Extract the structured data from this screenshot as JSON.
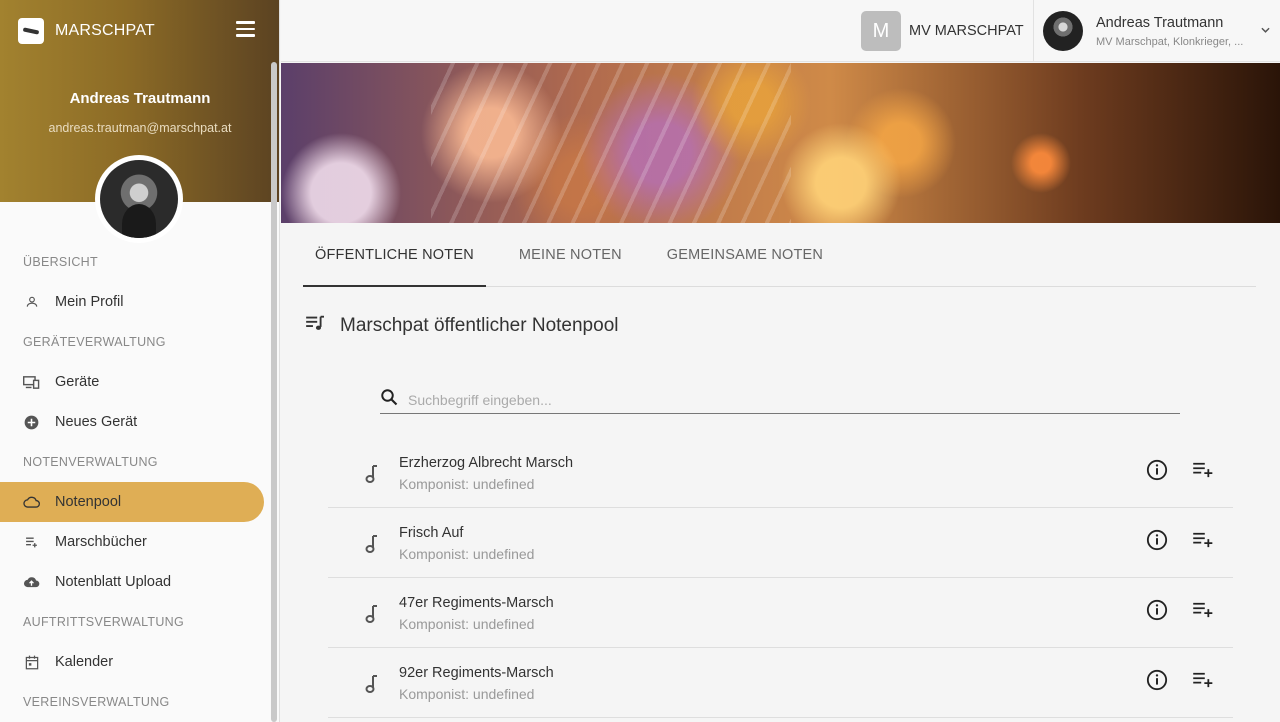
{
  "brand": {
    "name": "MARSCHPAT"
  },
  "profile": {
    "name": "Andreas Trautmann",
    "email": "andreas.trautman@marschpat.at"
  },
  "nav": {
    "sections": [
      {
        "label": "ÜBERSICHT",
        "items": [
          {
            "label": "Mein Profil",
            "icon": "person-icon"
          }
        ]
      },
      {
        "label": "GERÄTEVERWALTUNG",
        "items": [
          {
            "label": "Geräte",
            "icon": "devices-icon"
          },
          {
            "label": "Neues Gerät",
            "icon": "add-circle-icon"
          }
        ]
      },
      {
        "label": "NOTENVERWALTUNG",
        "items": [
          {
            "label": "Notenpool",
            "icon": "cloud-icon",
            "active": true
          },
          {
            "label": "Marschbücher",
            "icon": "playlist-icon"
          },
          {
            "label": "Notenblatt Upload",
            "icon": "cloud-upload-icon"
          }
        ]
      },
      {
        "label": "AUFTRITTSVERWALTUNG",
        "items": [
          {
            "label": "Kalender",
            "icon": "calendar-icon"
          }
        ]
      },
      {
        "label": "VEREINSVERWALTUNG",
        "items": []
      }
    ]
  },
  "topbar": {
    "org_initial": "M",
    "org_name": "MV MARSCHPAT",
    "user_name": "Andreas Trautmann",
    "user_sub": "MV Marschpat, Klonkrieger, ..."
  },
  "tabs": [
    "ÖFFENTLICHE NOTEN",
    "MEINE NOTEN",
    "GEMEINSAME NOTEN"
  ],
  "section_title": "Marschpat öffentlicher Notenpool",
  "search": {
    "placeholder": "Suchbegriff eingeben..."
  },
  "items": [
    {
      "title": "Erzherzog Albrecht Marsch",
      "composer": "Komponist: undefined"
    },
    {
      "title": "Frisch Auf",
      "composer": "Komponist: undefined"
    },
    {
      "title": "47er Regiments-Marsch",
      "composer": "Komponist: undefined"
    },
    {
      "title": "92er Regiments-Marsch",
      "composer": "Komponist: undefined"
    }
  ],
  "colors": {
    "accent": "#dfae55",
    "header_start": "#a2822f",
    "header_end": "#5b4222"
  }
}
